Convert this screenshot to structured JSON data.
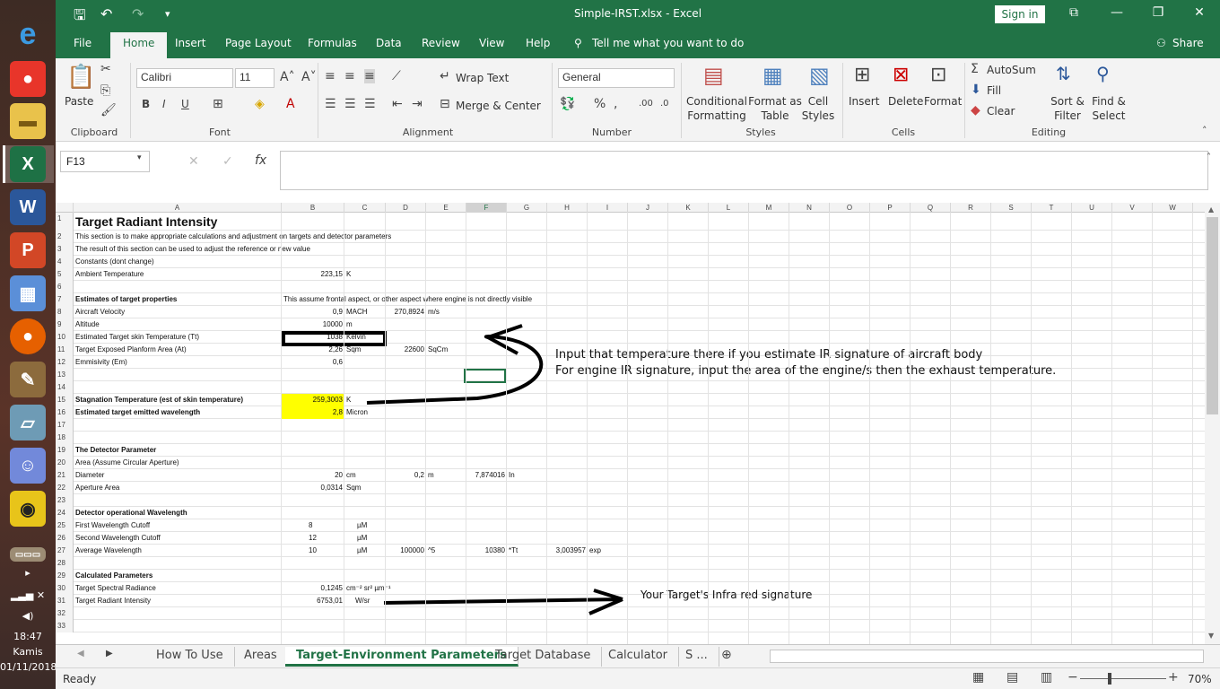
{
  "title": "Simple-IRST.xlsx  -  Excel",
  "sign_in": "Sign in",
  "share": "Share",
  "tell_me": "Tell me what you want to do",
  "tabs": [
    "File",
    "Home",
    "Insert",
    "Page Layout",
    "Formulas",
    "Data",
    "Review",
    "View",
    "Help"
  ],
  "ribbon": {
    "paste": "Paste",
    "clipboard": "Clipboard",
    "font_name": "Calibri",
    "font_size": "11",
    "font": "Font",
    "wrap_text": "Wrap Text",
    "merge_center": "Merge & Center",
    "alignment": "Alignment",
    "number_format": "General",
    "number": "Number",
    "conditional_formatting": "Conditional Formatting",
    "format_as_table": "Format as Table",
    "cell_styles": "Cell Styles",
    "styles": "Styles",
    "insert": "Insert",
    "delete": "Delete",
    "format": "Format",
    "cells": "Cells",
    "autosum": "AutoSum",
    "fill": "Fill",
    "clear": "Clear",
    "sort_filter": "Sort & Filter",
    "find_select": "Find & Select",
    "editing": "Editing"
  },
  "name_box": "F13",
  "columns": [
    "A",
    "B",
    "C",
    "D",
    "E",
    "F",
    "G",
    "H",
    "I",
    "J",
    "K",
    "L",
    "M",
    "N",
    "O",
    "P",
    "Q",
    "R",
    "S",
    "T",
    "U",
    "V",
    "W"
  ],
  "rows": [
    {
      "n": "1",
      "A": "Target Radiant Intensity"
    },
    {
      "n": "2",
      "A": "This section is to make appropriate calculations and adjustment on targets and detector parameters"
    },
    {
      "n": "3",
      "A": "The result of this section can be used to adjust the reference or new value"
    },
    {
      "n": "4",
      "A": "Constants (dont change)"
    },
    {
      "n": "5",
      "A": "Ambient Temperature",
      "B": "223,15",
      "C": "K"
    },
    {
      "n": "6"
    },
    {
      "n": "7",
      "A": "Estimates of target  properties",
      "B": "This assume frontal aspect, or other aspect where engine is not directly visible"
    },
    {
      "n": "8",
      "A": "Aircraft Velocity",
      "B": "0,9",
      "C": "MACH",
      "D": "270,8924",
      "E": "m/s"
    },
    {
      "n": "9",
      "A": "Altitude",
      "B": "10000",
      "C": "m"
    },
    {
      "n": "10",
      "A": "Estimated Target skin Temperature (Tt)",
      "B": "1038",
      "C": "Kelvin"
    },
    {
      "n": "11",
      "A": "Target Exposed Planform Area (At)",
      "B": "2,26",
      "C": "Sqm",
      "D": "22600",
      "E": "SqCm"
    },
    {
      "n": "12",
      "A": "Emmisivity (Em)",
      "B": "0,6"
    },
    {
      "n": "13"
    },
    {
      "n": "14"
    },
    {
      "n": "15",
      "A": "Stagnation Temperature (est of skin temperature)",
      "B": "259,3003",
      "C": "K"
    },
    {
      "n": "16",
      "A": "Estimated target emitted wavelength",
      "B": "2,8",
      "C": "Micron"
    },
    {
      "n": "17"
    },
    {
      "n": "18"
    },
    {
      "n": "19",
      "A": "The Detector Parameter"
    },
    {
      "n": "20",
      "A": "Area (Assume Circular Aperture)"
    },
    {
      "n": "21",
      "A": "Diameter",
      "B": "20",
      "C": "cm",
      "D": "0,2",
      "E": "m",
      "F": "7,874016",
      "G": "In"
    },
    {
      "n": "22",
      "A": "Aperture Area",
      "B": "0,0314",
      "C": "Sqm"
    },
    {
      "n": "23"
    },
    {
      "n": "24",
      "A": "Detector operational Wavelength"
    },
    {
      "n": "25",
      "A": "First Wavelength Cutoff",
      "B": "8",
      "C": "µM"
    },
    {
      "n": "26",
      "A": "Second Wavelength Cutoff",
      "B": "12",
      "C": "µM"
    },
    {
      "n": "27",
      "A": "Average Wavelength",
      "B": "10",
      "C": "µM",
      "D": "100000",
      "E": "^5",
      "F": "10380",
      "G": "*Tt",
      "H": "3,003957",
      "I": "exp"
    },
    {
      "n": "28"
    },
    {
      "n": "29",
      "A": "Calculated Parameters"
    },
    {
      "n": "30",
      "A": "Target Spectral Radiance",
      "B": "0,1245",
      "C": "cm⁻² sr² µm⁻¹"
    },
    {
      "n": "31",
      "A": "Target Radiant Intensity",
      "B": "6753,01",
      "C": "W/sr"
    },
    {
      "n": "32"
    },
    {
      "n": "33"
    }
  ],
  "annotations": {
    "note1": "Input that temperature there if you estimate IR signature of aircraft body",
    "note2": "For engine IR signature, input the area of the engine/s then the exhaust temperature.",
    "note3": "Your Target's Infra red signature"
  },
  "sheet_tabs": [
    "How To Use",
    "Areas",
    "Target-Environment Parameters",
    "Target Database",
    "Calculator",
    "S ..."
  ],
  "active_sheet": "Target-Environment Parameters",
  "status": "Ready",
  "zoom": "70%",
  "clock": {
    "time": "18:47",
    "day": "Kamis",
    "date": "01/11/2018"
  },
  "colors": {
    "excel_green": "#217346",
    "highlight": "#ffff00"
  }
}
